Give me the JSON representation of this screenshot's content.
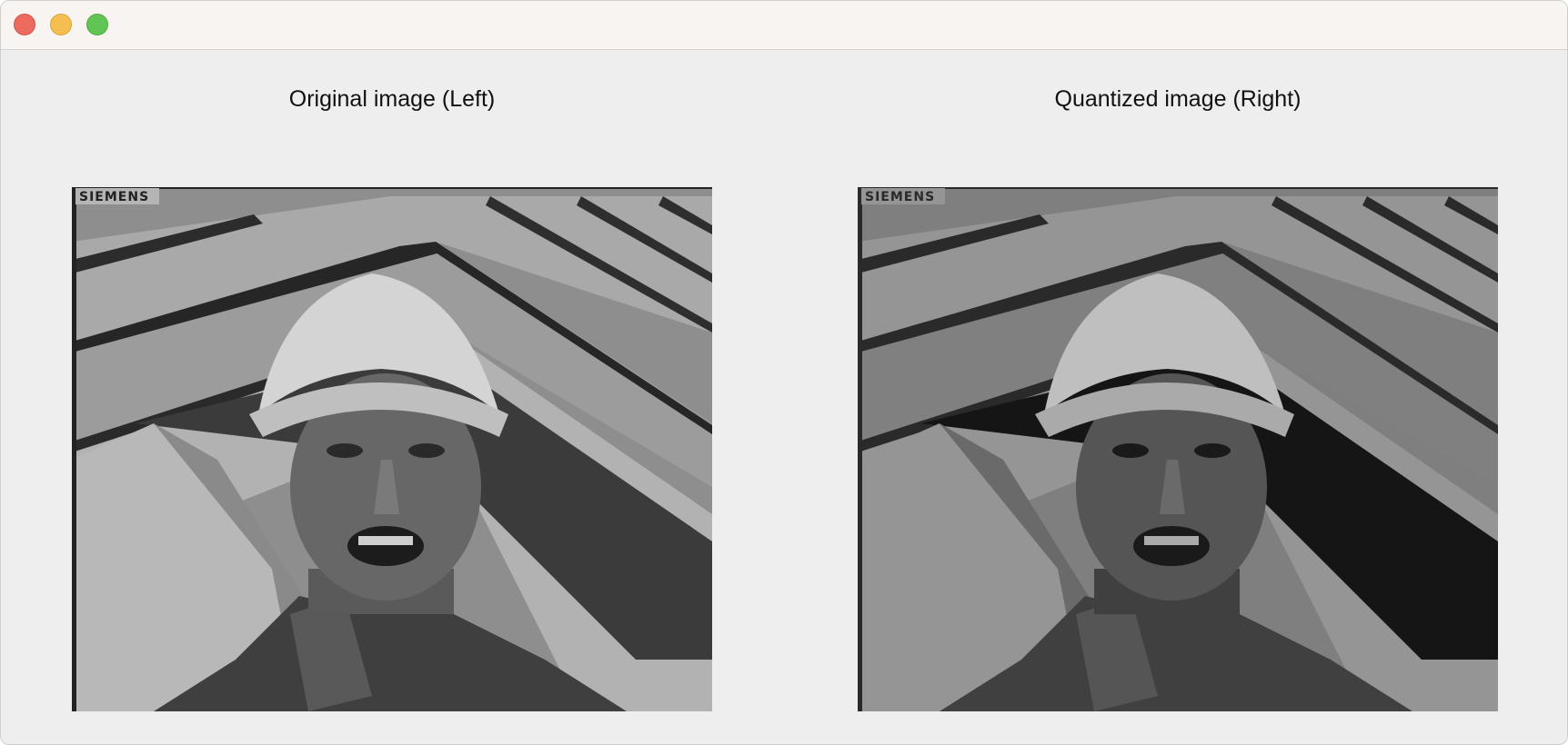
{
  "window": {
    "buttons": [
      "close",
      "minimize",
      "zoom"
    ]
  },
  "panels": {
    "left": {
      "caption": "Original image (Left)",
      "logo_text": "SIEMENS"
    },
    "right": {
      "caption": "Quantized image (Right)",
      "logo_text": "SIEMENS"
    }
  },
  "colors": {
    "window_bg": "#eeeeee",
    "titlebar_bg": "#f8f4f1",
    "close": "#ec6a5e",
    "minimize": "#f4bf4f",
    "zoom": "#61c554"
  }
}
